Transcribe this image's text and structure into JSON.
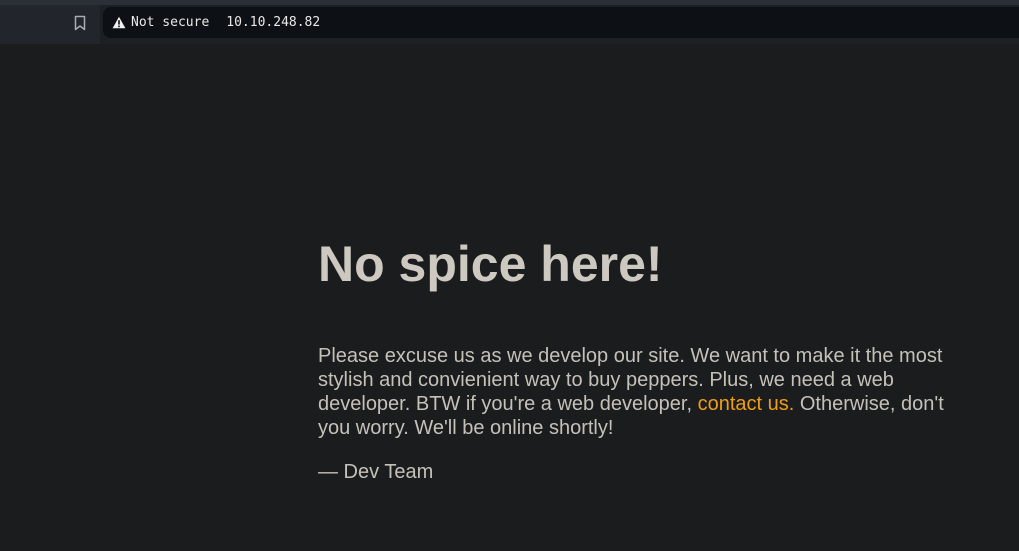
{
  "browser": {
    "security_label": "Not secure",
    "url": "10.10.248.82",
    "icons": {
      "bookmark": "bookmark-icon",
      "warning": "warning-triangle-icon"
    }
  },
  "page": {
    "heading": "No spice here!",
    "body_before_link": "Please excuse us as we develop our site. We want to make it the most stylish and convienient way to buy peppers. Plus, we need a web developer. BTW if you're a web developer, ",
    "link_text": "contact us.",
    "body_after_link": " Otherwise, don't you worry. We'll be online shortly!",
    "signature": "— Dev Team"
  },
  "colors": {
    "background": "#1b1c1e",
    "heading": "#cdc8c0",
    "text": "#c5c1b9",
    "link": "#ee9e16"
  }
}
